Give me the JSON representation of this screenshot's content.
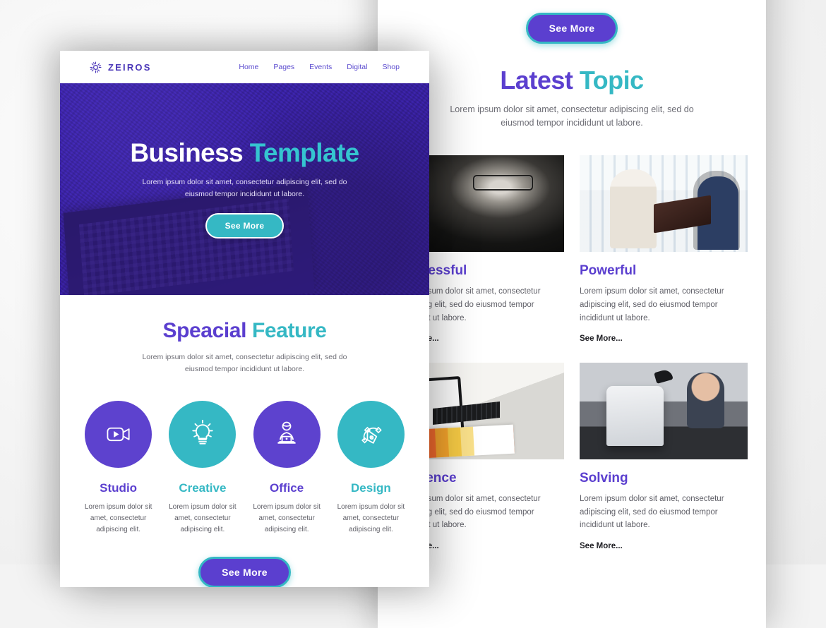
{
  "theme": {
    "purple": "#5b3fcf",
    "teal": "#35b8c4",
    "body_text": "#5f5f67",
    "page_bg": "#f2f2f2"
  },
  "back_page": {
    "top_button": {
      "label": "See More",
      "name": "see-more-top"
    },
    "heading": {
      "part1": "Latest",
      "part2": "Topic"
    },
    "subtitle": "Lorem ipsum dolor sit amet, consectetur adipiscing elit, sed do eiusmod tempor incididunt ut labore.",
    "cards": [
      {
        "title": "Successful",
        "text": "Lorem ipsum dolor sit amet, consectetur adipiscing elit, sed do eiusmod tempor incididunt ut labore.",
        "more": "See More...",
        "image": "portrait-man-glasses-bw"
      },
      {
        "title": "Powerful",
        "text": "Lorem ipsum dolor sit amet, consectetur adipiscing elit, sed do eiusmod tempor incididunt ut labore.",
        "more": "See More...",
        "image": "two-businessmen-laptop"
      },
      {
        "title": "Audience",
        "text": "Lorem ipsum dolor sit amet, consectetur adipiscing elit, sed do eiusmod tempor incididunt ut labore.",
        "more": "See More...",
        "image": "desk-tablet-charts"
      },
      {
        "title": "Solving",
        "text": "Lorem ipsum dolor sit amet, consectetur adipiscing elit, sed do eiusmod tempor incididunt ut labore.",
        "more": "See More...",
        "image": "team-imac-office"
      }
    ]
  },
  "front_page": {
    "nav": {
      "logo_icon": "sunburst-icon",
      "brand": "ZEIROS",
      "links": [
        {
          "label": "Home"
        },
        {
          "label": "Pages"
        },
        {
          "label": "Events"
        },
        {
          "label": "Digital"
        },
        {
          "label": "Shop"
        }
      ]
    },
    "hero": {
      "title_part1": "Business",
      "title_part2": "Template",
      "subtitle": "Lorem ipsum dolor sit amet, consectetur adipiscing elit, sed do eiusmod tempor incididunt ut labore.",
      "button": "See More",
      "image": "person-with-laptop-purple-tint"
    },
    "feature": {
      "heading_part1": "Speacial",
      "heading_part2": "Feature",
      "subtitle": "Lorem ipsum dolor sit amet, consectetur adipiscing elit, sed do eiusmod tempor incididunt ut labore.",
      "items": [
        {
          "name": "Studio",
          "icon": "video-camera-icon",
          "text": "Lorem ipsum dolor sit amet, consectetur adipiscing elit."
        },
        {
          "name": "Creative",
          "icon": "lightbulb-icon",
          "text": "Lorem ipsum dolor sit amet, consectetur adipiscing elit."
        },
        {
          "name": "Office",
          "icon": "person-laptop-icon",
          "text": "Lorem ipsum dolor sit amet, consectetur adipiscing elit."
        },
        {
          "name": "Design",
          "icon": "pen-tool-icon",
          "text": "Lorem ipsum dolor sit amet, consectetur adipiscing elit."
        }
      ],
      "button": "See More"
    }
  }
}
